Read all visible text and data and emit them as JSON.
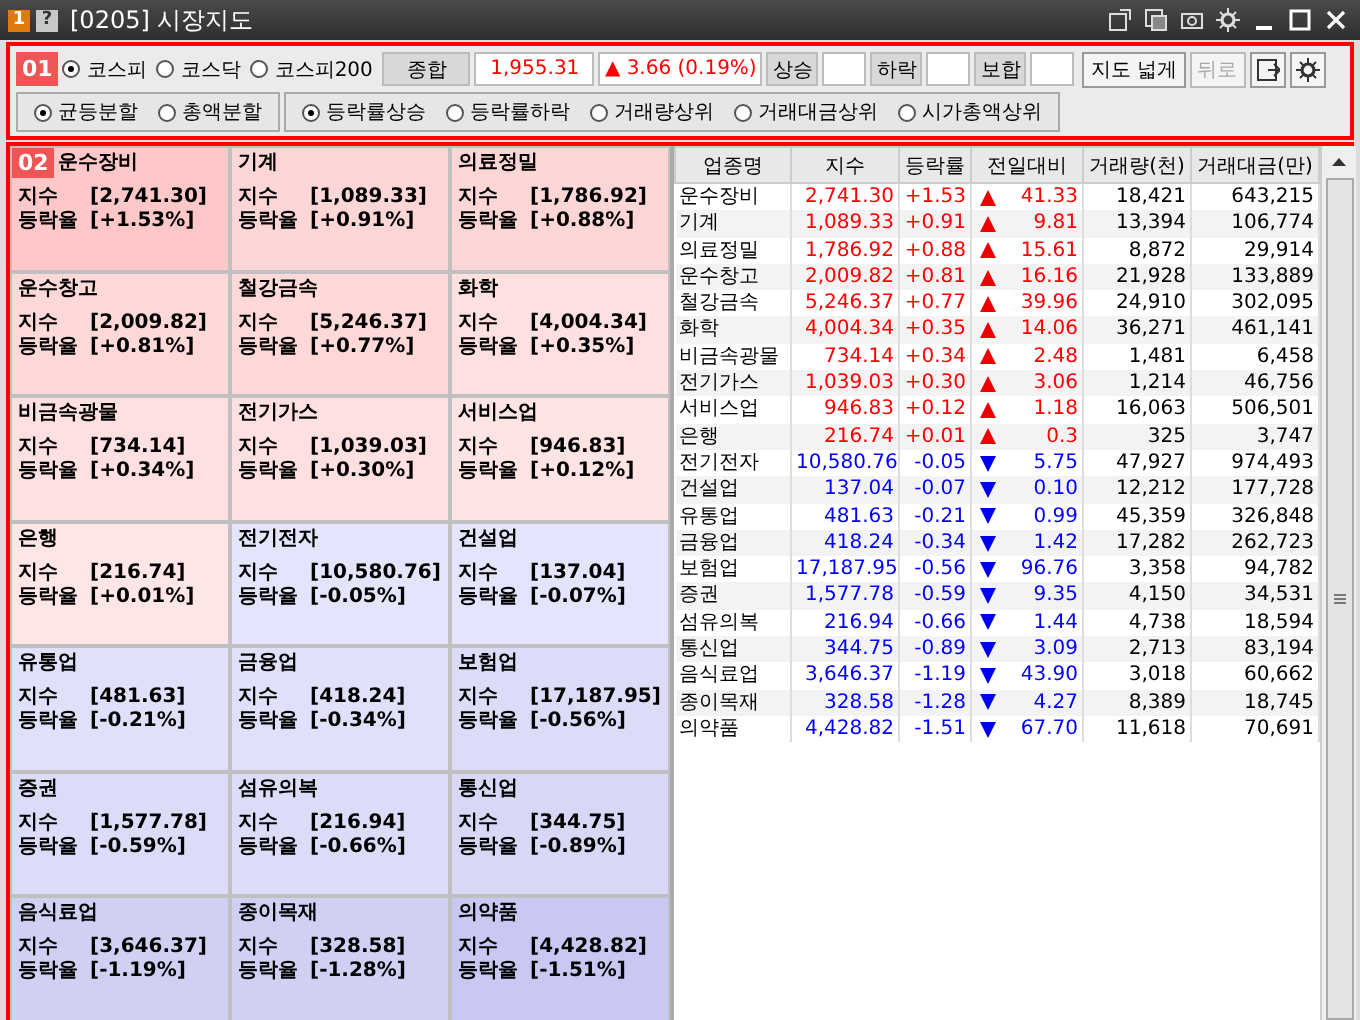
{
  "window": {
    "badge": "1",
    "help": "?",
    "title": "[0205] 시장지도"
  },
  "toolbar": {
    "section_badge": "01",
    "markets": [
      {
        "label": "코스피",
        "selected": true
      },
      {
        "label": "코스닥",
        "selected": false
      },
      {
        "label": "코스피200",
        "selected": false
      }
    ],
    "index": {
      "label": "종합",
      "value": "1,955.31",
      "change": "▲ 3.66 (0.19%)"
    },
    "counters": [
      {
        "label": "상승"
      },
      {
        "label": "하락"
      },
      {
        "label": "보합"
      }
    ],
    "buttons": [
      {
        "label": "지도 넓게",
        "disabled": false
      },
      {
        "label": "뒤로",
        "disabled": true
      }
    ],
    "split_options": [
      {
        "label": "균등분할",
        "selected": true
      },
      {
        "label": "총액분할",
        "selected": false
      }
    ],
    "sort_options": [
      {
        "label": "등락률상승",
        "selected": true
      },
      {
        "label": "등락률하락",
        "selected": false
      },
      {
        "label": "거래량상위",
        "selected": false
      },
      {
        "label": "거래대금상위",
        "selected": false
      },
      {
        "label": "시가총액상위",
        "selected": false
      }
    ]
  },
  "map": {
    "section_badge": "02",
    "tiles": [
      {
        "name": "운수장비",
        "index_label": "지수",
        "index": "[2,741.30]",
        "rate_label": "등락율",
        "rate": "[+1.53%]",
        "color": "#ffc8c8"
      },
      {
        "name": "기계",
        "index_label": "지수",
        "index": "[1,089.33]",
        "rate_label": "등락율",
        "rate": "[+0.91%]",
        "color": "#ffd6d6"
      },
      {
        "name": "의료정밀",
        "index_label": "지수",
        "index": "[1,786.92]",
        "rate_label": "등락율",
        "rate": "[+0.88%]",
        "color": "#ffd6d6"
      },
      {
        "name": "운수창고",
        "index_label": "지수",
        "index": "[2,009.82]",
        "rate_label": "등락율",
        "rate": "[+0.81%]",
        "color": "#ffd8d8"
      },
      {
        "name": "철강금속",
        "index_label": "지수",
        "index": "[5,246.37]",
        "rate_label": "등락율",
        "rate": "[+0.77%]",
        "color": "#ffd8d8"
      },
      {
        "name": "화학",
        "index_label": "지수",
        "index": "[4,004.34]",
        "rate_label": "등락율",
        "rate": "[+0.35%]",
        "color": "#ffe0e0"
      },
      {
        "name": "비금속광물",
        "index_label": "지수",
        "index": "[734.14]",
        "rate_label": "등락율",
        "rate": "[+0.34%]",
        "color": "#ffe0e0"
      },
      {
        "name": "전기가스",
        "index_label": "지수",
        "index": "[1,039.03]",
        "rate_label": "등락율",
        "rate": "[+0.30%]",
        "color": "#ffe0e0"
      },
      {
        "name": "서비스업",
        "index_label": "지수",
        "index": "[946.83]",
        "rate_label": "등락율",
        "rate": "[+0.12%]",
        "color": "#ffe4e4"
      },
      {
        "name": "은행",
        "index_label": "지수",
        "index": "[216.74]",
        "rate_label": "등락율",
        "rate": "[+0.01%]",
        "color": "#ffe6e6"
      },
      {
        "name": "전기전자",
        "index_label": "지수",
        "index": "[10,580.76]",
        "rate_label": "등락율",
        "rate": "[-0.05%]",
        "color": "#e4e4fc"
      },
      {
        "name": "건설업",
        "index_label": "지수",
        "index": "[137.04]",
        "rate_label": "등락율",
        "rate": "[-0.07%]",
        "color": "#e4e4fc"
      },
      {
        "name": "유통업",
        "index_label": "지수",
        "index": "[481.63]",
        "rate_label": "등락율",
        "rate": "[-0.21%]",
        "color": "#e0e0fa"
      },
      {
        "name": "금융업",
        "index_label": "지수",
        "index": "[418.24]",
        "rate_label": "등락율",
        "rate": "[-0.34%]",
        "color": "#e0e0fa"
      },
      {
        "name": "보험업",
        "index_label": "지수",
        "index": "[17,187.95]",
        "rate_label": "등락율",
        "rate": "[-0.56%]",
        "color": "#dcdcf8"
      },
      {
        "name": "증권",
        "index_label": "지수",
        "index": "[1,577.78]",
        "rate_label": "등락율",
        "rate": "[-0.59%]",
        "color": "#dcdcf8"
      },
      {
        "name": "섬유의복",
        "index_label": "지수",
        "index": "[216.94]",
        "rate_label": "등락율",
        "rate": "[-0.66%]",
        "color": "#dcdcf8"
      },
      {
        "name": "통신업",
        "index_label": "지수",
        "index": "[344.75]",
        "rate_label": "등락율",
        "rate": "[-0.89%]",
        "color": "#d8d8f6"
      },
      {
        "name": "음식료업",
        "index_label": "지수",
        "index": "[3,646.37]",
        "rate_label": "등락율",
        "rate": "[-1.19%]",
        "color": "#d0d0f4"
      },
      {
        "name": "종이목재",
        "index_label": "지수",
        "index": "[328.58]",
        "rate_label": "등락율",
        "rate": "[-1.28%]",
        "color": "#d0d0f4"
      },
      {
        "name": "의약품",
        "index_label": "지수",
        "index": "[4,428.82]",
        "rate_label": "등락율",
        "rate": "[-1.51%]",
        "color": "#c8c8f2"
      }
    ]
  },
  "table": {
    "columns": [
      "업종명",
      "지수",
      "등락률",
      "전일대비",
      "거래량(천)",
      "거래대금(만)"
    ],
    "rows": [
      {
        "kind": "up",
        "cells": [
          "운수장비",
          "2,741.30",
          "+1.53",
          "41.33",
          "18,421",
          "643,215"
        ]
      },
      {
        "kind": "up",
        "cells": [
          "기계",
          "1,089.33",
          "+0.91",
          "9.81",
          "13,394",
          "106,774"
        ]
      },
      {
        "kind": "up",
        "cells": [
          "의료정밀",
          "1,786.92",
          "+0.88",
          "15.61",
          "8,872",
          "29,914"
        ]
      },
      {
        "kind": "up",
        "cells": [
          "운수창고",
          "2,009.82",
          "+0.81",
          "16.16",
          "21,928",
          "133,889"
        ]
      },
      {
        "kind": "up",
        "cells": [
          "철강금속",
          "5,246.37",
          "+0.77",
          "39.96",
          "24,910",
          "302,095"
        ]
      },
      {
        "kind": "up",
        "cells": [
          "화학",
          "4,004.34",
          "+0.35",
          "14.06",
          "36,271",
          "461,141"
        ]
      },
      {
        "kind": "up",
        "cells": [
          "비금속광물",
          "734.14",
          "+0.34",
          "2.48",
          "1,481",
          "6,458"
        ]
      },
      {
        "kind": "up",
        "cells": [
          "전기가스",
          "1,039.03",
          "+0.30",
          "3.06",
          "1,214",
          "46,756"
        ]
      },
      {
        "kind": "up",
        "cells": [
          "서비스업",
          "946.83",
          "+0.12",
          "1.18",
          "16,063",
          "506,501"
        ]
      },
      {
        "kind": "up",
        "cells": [
          "은행",
          "216.74",
          "+0.01",
          "0.3",
          "325",
          "3,747"
        ]
      },
      {
        "kind": "down",
        "cells": [
          "전기전자",
          "10,580.76",
          "-0.05",
          "5.75",
          "47,927",
          "974,493"
        ]
      },
      {
        "kind": "down",
        "cells": [
          "건설업",
          "137.04",
          "-0.07",
          "0.10",
          "12,212",
          "177,728"
        ]
      },
      {
        "kind": "down",
        "cells": [
          "유통업",
          "481.63",
          "-0.21",
          "0.99",
          "45,359",
          "326,848"
        ]
      },
      {
        "kind": "down",
        "cells": [
          "금융업",
          "418.24",
          "-0.34",
          "1.42",
          "17,282",
          "262,723"
        ]
      },
      {
        "kind": "down",
        "cells": [
          "보험업",
          "17,187.95",
          "-0.56",
          "96.76",
          "3,358",
          "94,782"
        ]
      },
      {
        "kind": "down",
        "cells": [
          "증권",
          "1,577.78",
          "-0.59",
          "9.35",
          "4,150",
          "34,531"
        ]
      },
      {
        "kind": "down",
        "cells": [
          "섬유의복",
          "216.94",
          "-0.66",
          "1.44",
          "4,738",
          "18,594"
        ]
      },
      {
        "kind": "down",
        "cells": [
          "통신업",
          "344.75",
          "-0.89",
          "3.09",
          "2,713",
          "83,194"
        ]
      },
      {
        "kind": "down",
        "cells": [
          "음식료업",
          "3,646.37",
          "-1.19",
          "43.90",
          "3,018",
          "60,662"
        ]
      },
      {
        "kind": "down",
        "cells": [
          "종이목재",
          "328.58",
          "-1.28",
          "4.27",
          "8,389",
          "18,745"
        ]
      },
      {
        "kind": "down",
        "cells": [
          "의약품",
          "4,428.82",
          "-1.51",
          "67.70",
          "11,618",
          "70,691"
        ]
      }
    ]
  }
}
